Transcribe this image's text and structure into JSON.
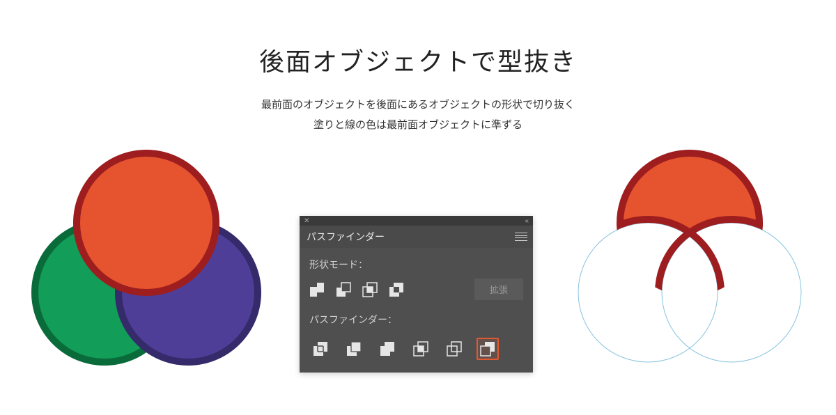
{
  "title": "後面オブジェクトで型抜き",
  "subtitle": {
    "line1": "最前面のオブジェクトを後面にあるオブジェクトの形状で切り抜く",
    "line2": "塗りと線の色は最前面オブジェクトに準ずる"
  },
  "panel": {
    "tab": "パスファインダー",
    "sections": {
      "shapeMode": "形状モード：",
      "pathfinder": "パスファインダー："
    },
    "expand": "拡張"
  },
  "colors": {
    "red_fill": "#e6542f",
    "red_stroke": "#9e1d1f",
    "green_fill": "#129d58",
    "green_stroke": "#0a6b3a",
    "blue_fill": "#4f3e98",
    "blue_stroke": "#352a6a",
    "outline_light": "#87c3de",
    "panel_accent": "#e5572e"
  }
}
